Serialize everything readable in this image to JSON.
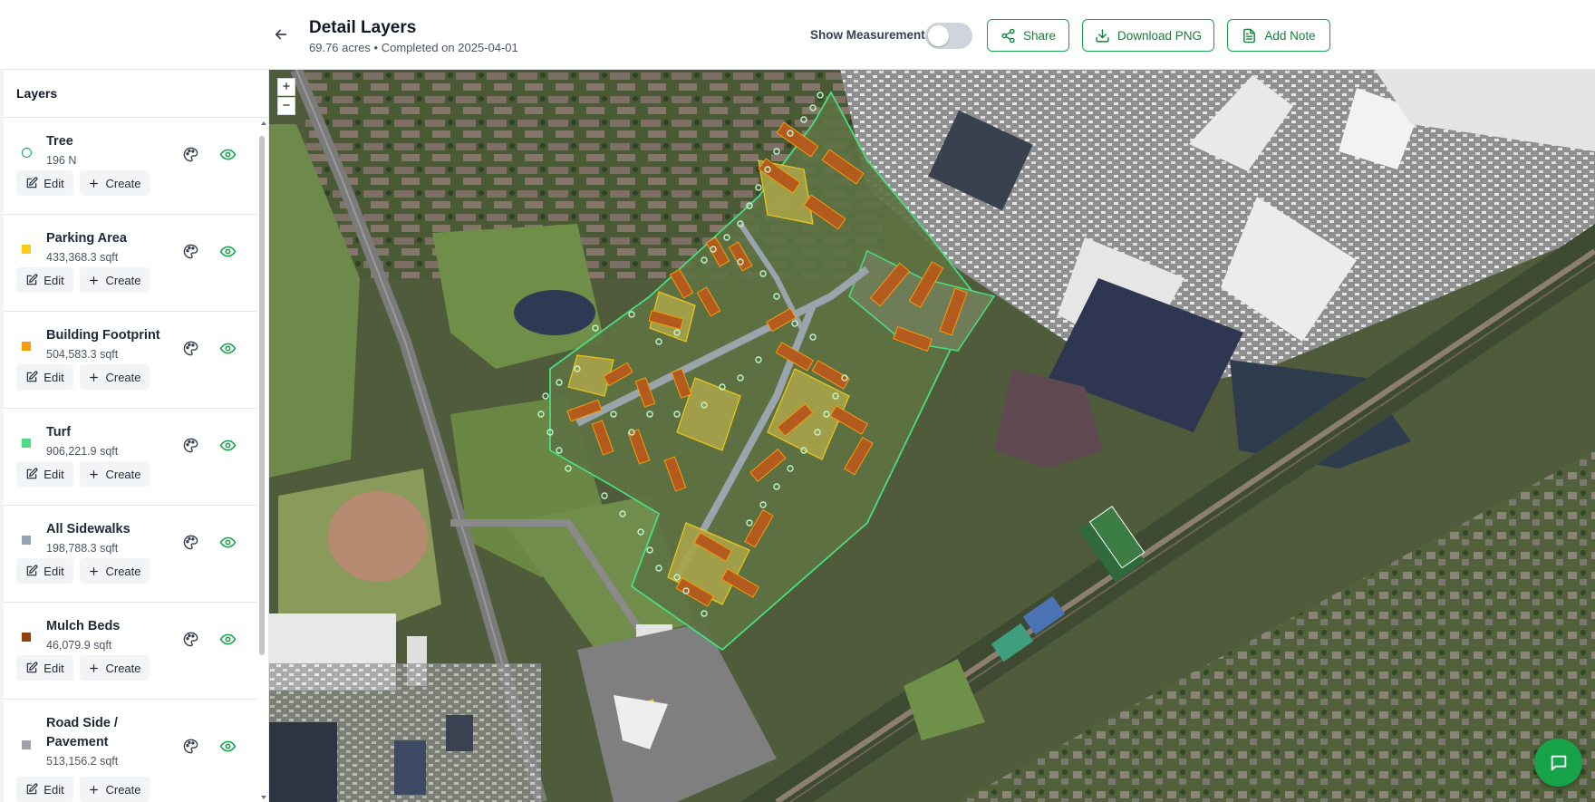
{
  "header": {
    "title": "Detail Layers",
    "subtitle": "69.76 acres • Completed on 2025-04-01",
    "measurements_label": "Show Measurements",
    "share_label": "Share",
    "download_label": "Download PNG",
    "note_label": "Add Note"
  },
  "sidebar": {
    "title": "Layers",
    "edit_label": "Edit",
    "create_label": "Create",
    "layers": [
      {
        "name": "Tree",
        "value": "196 N",
        "color": "#16a34a",
        "marker": "ring"
      },
      {
        "name": "Parking Area",
        "value": "433,368.3 sqft",
        "color": "#facc15",
        "marker": "square"
      },
      {
        "name": "Building Footprint",
        "value": "504,583.3 sqft",
        "color": "#f59e0b",
        "marker": "square"
      },
      {
        "name": "Turf",
        "value": "906,221.9 sqft",
        "color": "#4ade80",
        "marker": "square"
      },
      {
        "name": "All Sidewalks",
        "value": "198,788.3 sqft",
        "color": "#94a3b8",
        "marker": "square"
      },
      {
        "name": "Mulch Beds",
        "value": "46,079.9 sqft",
        "color": "#92400e",
        "marker": "square"
      },
      {
        "name": "Road Side / Pavement",
        "value": "513,156.2 sqft",
        "color": "#9ca3af",
        "marker": "square"
      }
    ]
  },
  "map": {
    "zoom_in": "+",
    "zoom_out": "−"
  },
  "colors": {
    "accent": "#16a34a",
    "turf_outline": "#4ade80",
    "building": "#c2571a",
    "parking": "#facc15"
  }
}
